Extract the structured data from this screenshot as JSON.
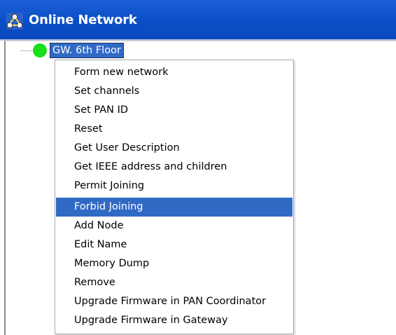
{
  "window": {
    "title": "Online Network",
    "title_icon": "network-tree-icon"
  },
  "tree": {
    "root_node": {
      "label": "GW. 6th Floor",
      "status_color": "#19e019",
      "selected": true
    }
  },
  "context_menu": {
    "highlighted_index": 7,
    "items": [
      {
        "label": "Form new network"
      },
      {
        "label": "Set channels"
      },
      {
        "label": "Set PAN ID"
      },
      {
        "label": "Reset"
      },
      {
        "label": "Get User Description"
      },
      {
        "label": "Get IEEE address and children"
      },
      {
        "label": "Permit Joining"
      },
      {
        "label": "Forbid Joining"
      },
      {
        "label": "Add Node"
      },
      {
        "label": "Edit Name"
      },
      {
        "label": "Memory Dump"
      },
      {
        "label": "Remove"
      },
      {
        "label": "Upgrade Firmware in PAN Coordinator"
      },
      {
        "label": "Upgrade Firmware in Gateway"
      }
    ]
  },
  "colors": {
    "titlebar": "#0a4ec6",
    "selection": "#316ac5",
    "online_status": "#19e019"
  }
}
